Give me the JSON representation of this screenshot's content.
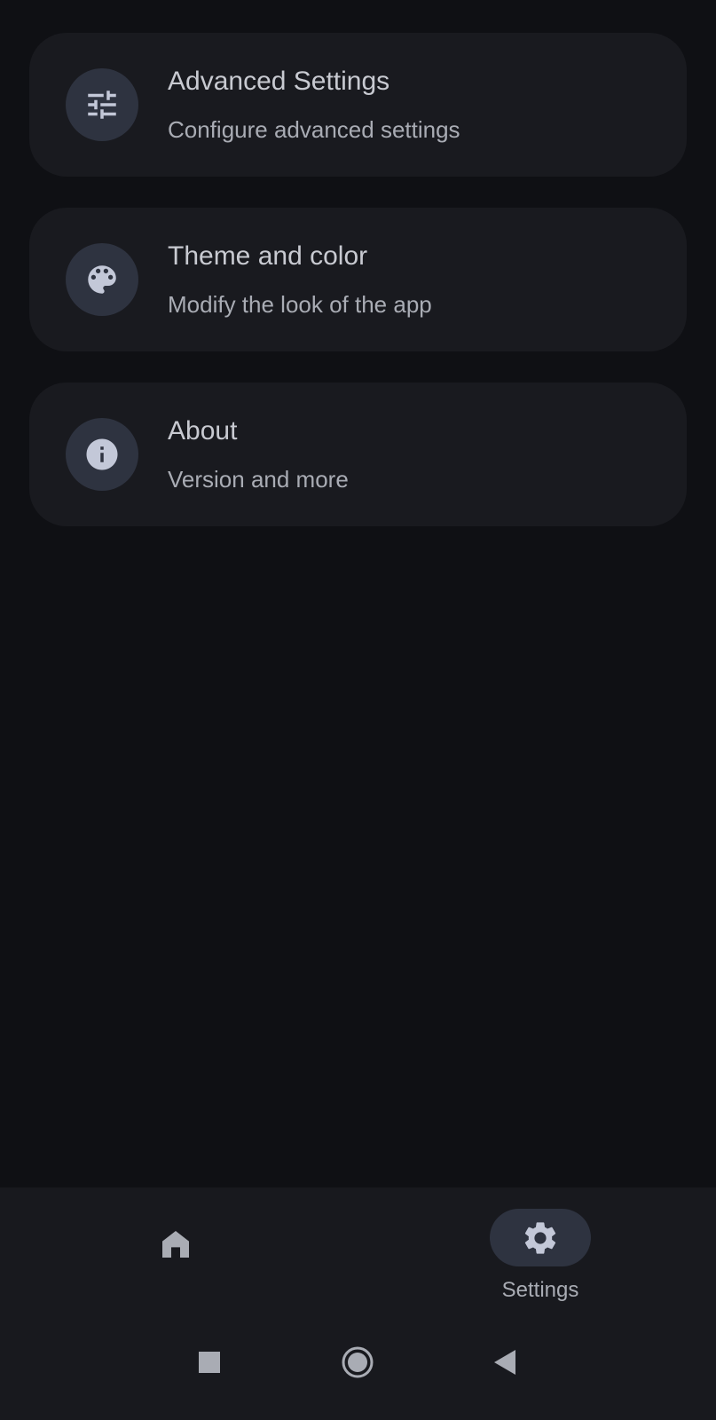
{
  "settings": {
    "items": [
      {
        "title": "Advanced Settings",
        "subtitle": "Configure advanced settings",
        "icon": "tune-icon"
      },
      {
        "title": "Theme and color",
        "subtitle": "Modify the look of the app",
        "icon": "palette-icon"
      },
      {
        "title": "About",
        "subtitle": "Version and more",
        "icon": "info-icon"
      }
    ]
  },
  "bottom_nav": {
    "home": {
      "icon": "home-icon"
    },
    "settings": {
      "label": "Settings",
      "icon": "gear-icon",
      "selected": true
    }
  },
  "system_nav": {
    "buttons": [
      "recents-square-icon",
      "home-circle-icon",
      "back-triangle-icon"
    ]
  },
  "colors": {
    "background": "#0f1014",
    "card": "#191a1f",
    "icon_circle": "#2e3340",
    "icon_glyph": "#c3c8d8",
    "text_primary": "#c8cad1",
    "text_secondary": "#a9acb4",
    "nav_bar": "#18191e"
  }
}
